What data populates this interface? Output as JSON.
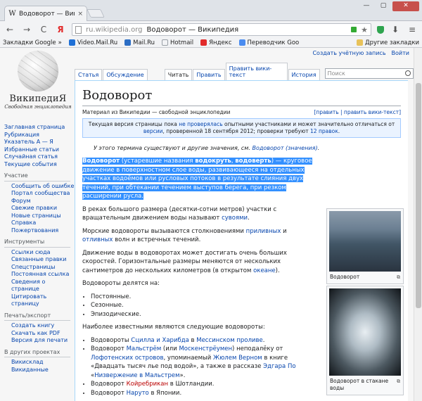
{
  "browser": {
    "tab_title": "Водоворот — Википедия",
    "tab_close": "×",
    "omnibox_url": "ru.wikipedia.org",
    "omnibox_title": "Водоворот — Википедия",
    "back": "←",
    "forward": "→",
    "reload": "C",
    "yandex": "Я",
    "download": "⬇",
    "menu": "≡",
    "win_min": "—",
    "win_max": "▢",
    "win_close": "✕"
  },
  "bookmarks": {
    "bar_label": "Закладки Google",
    "items": [
      {
        "label": "Video.Mail.Ru",
        "color": "#1f70d6"
      },
      {
        "label": "Mail.Ru",
        "color": "#2b6dc4"
      },
      {
        "label": "Hotmail",
        "color": "#9aa0a6"
      },
      {
        "label": "Яндекс",
        "color": "#e22b2b"
      },
      {
        "label": "Переводчик Goo",
        "color": "#4a8cf0"
      }
    ],
    "other": "Другие закладки"
  },
  "personal": {
    "create_account": "Создать учётную запись",
    "login": "Войти"
  },
  "logo": {
    "name": "ВикипедиЯ",
    "motto": "Свободная энциклопедия"
  },
  "sidebar": {
    "main": [
      "Заглавная страница",
      "Рубрикация",
      "Указатель А — Я",
      "Избранные статьи",
      "Случайная статья",
      "Текущие события"
    ],
    "participation": {
      "head": "Участие",
      "items": [
        "Сообщить об ошибке",
        "Портал сообщества",
        "Форум",
        "Свежие правки",
        "Новые страницы",
        "Справка",
        "Пожертвования"
      ]
    },
    "tools": {
      "head": "Инструменты",
      "items": [
        "Ссылки сюда",
        "Связанные правки",
        "Спецстраницы",
        "Постоянная ссылка",
        "Сведения о странице",
        "Цитировать страницу"
      ]
    },
    "print": {
      "head": "Печать/экспорт",
      "items": [
        "Создать книгу",
        "Скачать как PDF",
        "Версия для печати"
      ]
    },
    "projects": {
      "head": "В других проектах",
      "items": [
        "Викисклад",
        "Викиданные"
      ]
    }
  },
  "page_tabs": {
    "article": "Статья",
    "discussion": "Обсуждение",
    "read": "Читать",
    "edit": "Править",
    "edit_source": "Править вики-текст",
    "history": "История",
    "search_placeholder": "Поиск"
  },
  "article": {
    "title": "Водоворот",
    "from": "Материал из Википедии — свободной энциклопедии",
    "edit_links": "[править | править вики-текст]",
    "notice": {
      "t1": "Текущая версия страницы пока ",
      "l1": "не проверялась",
      "t2": " опытными участниками и может значительно отличаться от ",
      "l2": "версии",
      "t3": ", проверенной 18 сентября 2012; проверки требуют ",
      "l3": "12 правок",
      "t4": "."
    },
    "hatnote": {
      "t1": "У этого термина существуют и другие значения, см. ",
      "l1": "Водоворот (значения)",
      "t2": "."
    },
    "p1": {
      "b1": "Водоворот",
      "t1": " (устаревшие названия ",
      "b2": "водокруть",
      "t2": ", ",
      "b3": "водоверть",
      "t3": ") — круговое движение в поверхностном слое воды, развивающееся на отдельных участках водоёмов или русловых потоков в результате слияния двух течений, при обтекании течением выступов берега, при резком расширении русла."
    },
    "p2": {
      "t1": "В реках большого размера (десятки-сотни метров) участки с вращательным движением воды называют ",
      "l1": "сувоями",
      "t2": "."
    },
    "p3": {
      "t1": "Морские водовороты вызываются столкновениями ",
      "l1": "приливных",
      "t2": " и ",
      "l2": "отливных",
      "t3": " волн и встречных течений."
    },
    "p4": {
      "t1": "Движение воды в водоворотах может достигать очень больших скоростей. Горизонтальные размеры меняются от нескольких сантиметров до нескольких километров (в открытом ",
      "l1": "океане",
      "t2": ")."
    },
    "p5": "Водовороты делятся на:",
    "types": [
      "Постоянные.",
      "Сезонные.",
      "Эпизодические."
    ],
    "p6": "Наиболее известными являются следующие водовороты:",
    "famous": {
      "i1": {
        "t1": "Водовороты ",
        "l1": "Сцилла и Харибда",
        "t2": " в ",
        "l2": "Мессинском проливе",
        "t3": "."
      },
      "i2": {
        "t1": "Водоворот ",
        "l1": "Мальстрём",
        "t2": " (или ",
        "l2": "Москенстрёумен",
        "t3": ") неподалёку от ",
        "l3": "Лофотенских островов",
        "t4": ", упоминаемый ",
        "l4": "Жюлем Верном",
        "t5": " в книге «Двадцать тысяч лье под водой», а также в рассказе ",
        "l5": "Эдгара По",
        "t6": " «",
        "l6": "Низвержение в Мальстрем",
        "t7": "»."
      },
      "i3": {
        "t1": "Водоворот ",
        "l1": "Койребрикан",
        "t2": " в Шотландии."
      },
      "i4": {
        "t1": "Водоворот ",
        "l1": "Наруто",
        "t2": " в Японии."
      }
    }
  },
  "thumbs": {
    "t1": {
      "caption": "Водоворот"
    },
    "t2": {
      "caption": "Водоворот в стакане воды"
    },
    "magnify": "⧉"
  }
}
